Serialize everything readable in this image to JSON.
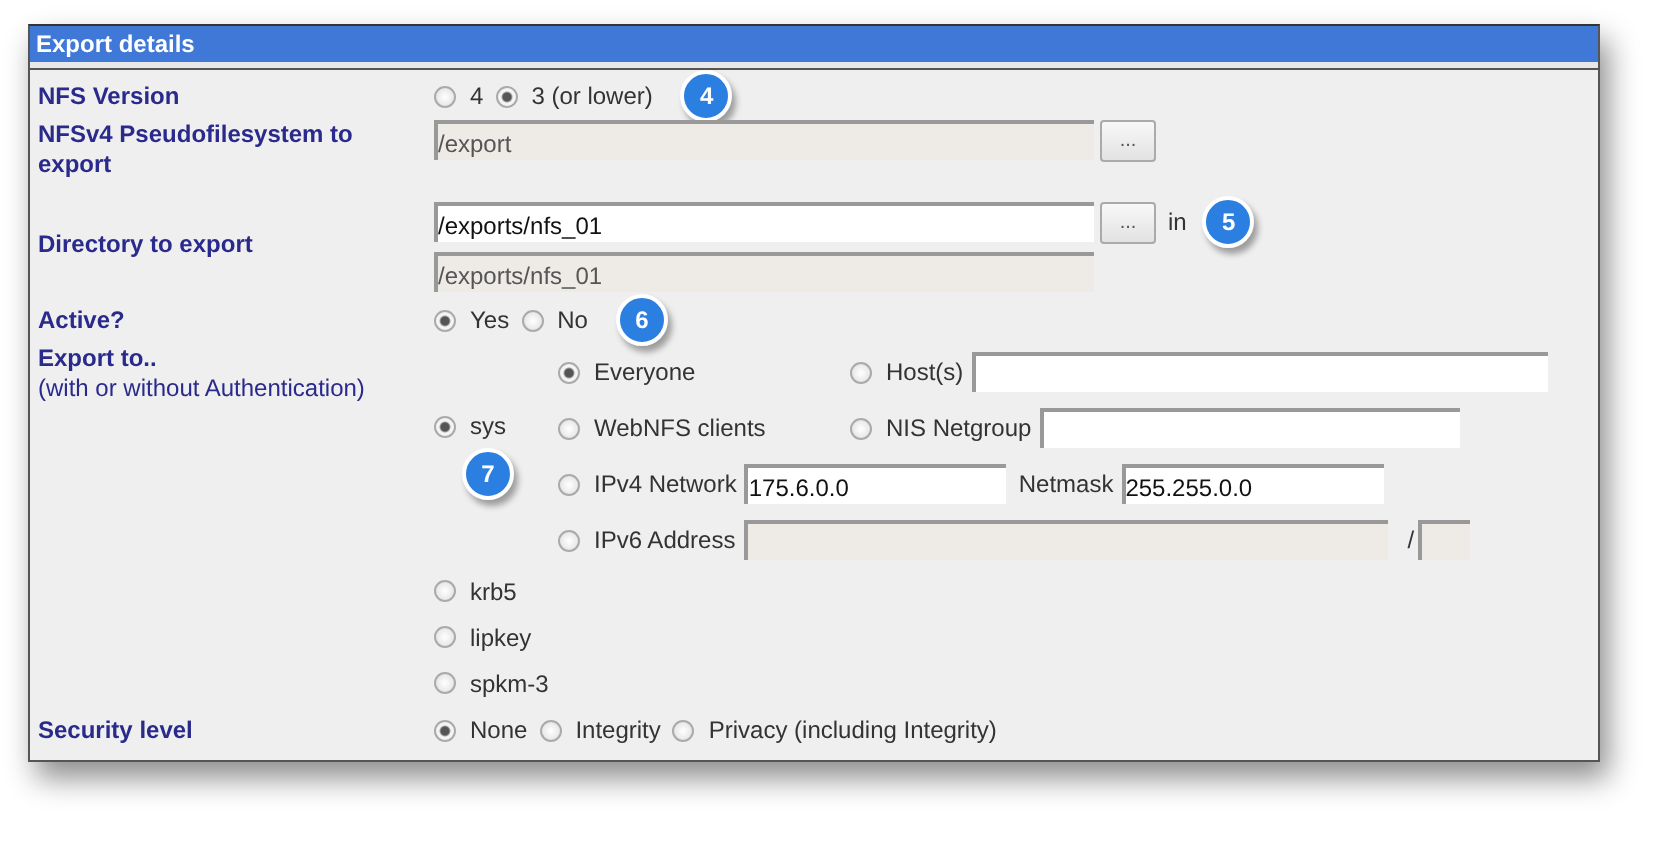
{
  "title": "Export details",
  "nfs_version": {
    "label": "NFS Version",
    "options": [
      {
        "label": "4",
        "selected": false
      },
      {
        "label": "3 (or lower)",
        "selected": true
      }
    ],
    "callout": "4"
  },
  "pseudo_fs": {
    "label": "NFSv4 Pseudofilesystem to export",
    "value": "/export",
    "disabled": true,
    "browse": "..."
  },
  "directory": {
    "label": "Directory to export",
    "value": "/exports/nfs_01",
    "browse": "...",
    "suffix": "in",
    "callout": "5",
    "resolved": "/exports/nfs_01"
  },
  "active": {
    "label": "Active?",
    "options": [
      {
        "label": "Yes",
        "selected": true
      },
      {
        "label": "No",
        "selected": false
      }
    ],
    "callout": "6"
  },
  "export_to": {
    "label": "Export to..",
    "note": "(with or without Authentication)",
    "callout": "7",
    "flavors": [
      {
        "label": "sys",
        "selected": true,
        "host_rows": [
          [
            {
              "kind": "radio",
              "label": "Everyone",
              "selected": true
            },
            {
              "kind": "field",
              "label": "Host(s)",
              "selected": false,
              "disabled": false
            }
          ],
          [
            {
              "kind": "radio",
              "label": "WebNFS clients",
              "selected": false
            },
            {
              "kind": "field",
              "label": "NIS Netgroup",
              "selected": false,
              "disabled": false
            }
          ],
          [
            {
              "kind": "netmask",
              "label": "IPv4 Network",
              "selected": false,
              "value": "175.6.0.0",
              "extra_label": "Netmask",
              "extra_value": "255.255.0.0"
            }
          ],
          [
            {
              "kind": "prefix",
              "label": "IPv6 Address",
              "selected": false,
              "disabled": true,
              "separator": "/"
            }
          ]
        ]
      },
      {
        "label": "krb5",
        "selected": false
      },
      {
        "label": "lipkey",
        "selected": false
      },
      {
        "label": "spkm-3",
        "selected": false
      }
    ]
  },
  "security_level": {
    "label": "Security level",
    "options": [
      {
        "label": "None",
        "selected": true
      },
      {
        "label": "Integrity",
        "selected": false
      },
      {
        "label": "Privacy (including Integrity)",
        "selected": false
      }
    ]
  }
}
